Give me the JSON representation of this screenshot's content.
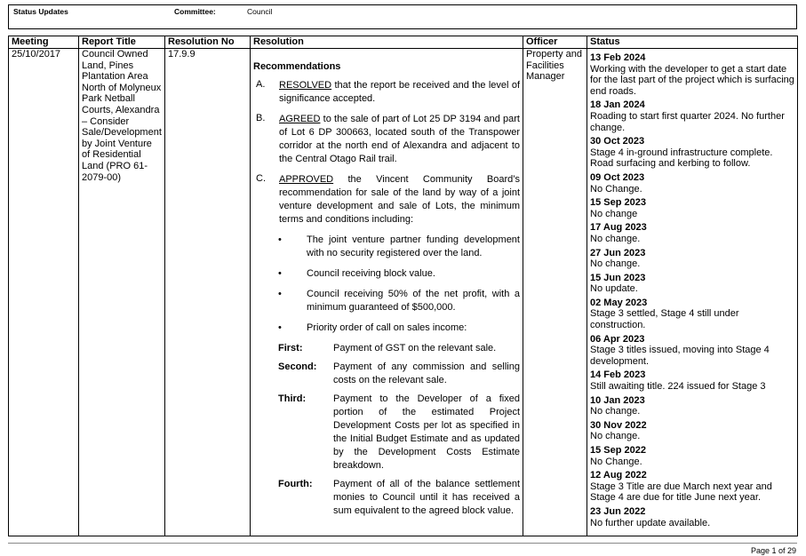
{
  "header": {
    "status_updates_label": "Status Updates",
    "committee_label": "Committee:",
    "committee_value": "Council"
  },
  "table": {
    "columns": [
      "Meeting",
      "Report Title",
      "Resolution No",
      "Resolution",
      "Officer",
      "Status"
    ],
    "row": {
      "meeting": "25/10/2017",
      "report_title": "Council Owned Land, Pines Plantation Area North of Molyneux Park Netball Courts, Alexandra – Consider Sale/Development by Joint Venture of Residential Land (PRO 61-2079-00)",
      "resolution_no": "17.9.9",
      "resolution": {
        "heading": "Recommendations",
        "items": [
          {
            "letter": "A.",
            "keyword": "RESOLVED",
            "text": " that the report be received and the level of significance accepted."
          },
          {
            "letter": "B.",
            "keyword": "AGREED",
            "text": " to the sale of part of Lot 25 DP 3194 and part of Lot 6 DP 300663, located south of the Transpower corridor at the north end of Alexandra and adjacent to the Central Otago Rail trail."
          },
          {
            "letter": "C.",
            "keyword": "APPROVED",
            "text": " the Vincent Community Board’s recommendation for sale of the land by way of a joint venture development and sale of Lots, the minimum terms and conditions including:"
          }
        ],
        "bullets": [
          "The joint venture partner funding development with no security registered over the land.",
          "Council receiving block value.",
          "Council receiving 50% of the net profit, with a minimum guaranteed of $500,000.",
          "Priority order of call on sales income:"
        ],
        "order": [
          {
            "label": "First:",
            "text": "Payment of GST on the relevant sale."
          },
          {
            "label": "Second:",
            "text": "Payment of any commission and selling costs on the relevant sale."
          },
          {
            "label": "Third:",
            "text": "Payment to the Developer of a fixed portion of the estimated Project Development Costs per lot as specified in the Initial Budget Estimate and as updated by the Development Costs Estimate breakdown."
          },
          {
            "label": "Fourth:",
            "text": "Payment of all of the balance settlement monies to Council until it has received a sum equivalent to the agreed block value."
          }
        ]
      },
      "officer": "Property and Facilities Manager",
      "status": [
        {
          "date": "13 Feb 2024",
          "note": "Working with the developer to get a start date for the last part of the project which is surfacing end roads."
        },
        {
          "date": "18 Jan 2024",
          "note": "Roading to start first quarter 2024. No further change."
        },
        {
          "date": "30 Oct 2023",
          "note": "Stage 4 in-ground infrastructure complete. Road surfacing and kerbing to follow."
        },
        {
          "date": "09 Oct 2023",
          "note": "No Change."
        },
        {
          "date": "15 Sep 2023",
          "note": "No change"
        },
        {
          "date": "17 Aug 2023",
          "note": "No change."
        },
        {
          "date": "27 Jun 2023",
          "note": "No change."
        },
        {
          "date": "15 Jun 2023",
          "note": "No update."
        },
        {
          "date": "02 May 2023",
          "note": "Stage 3 settled, Stage 4 still under construction."
        },
        {
          "date": "06 Apr 2023",
          "note": "Stage 3 titles issued, moving into Stage 4 development."
        },
        {
          "date": "14 Feb 2023",
          "note": "Still awaiting title. 224 issued for Stage 3"
        },
        {
          "date": "10 Jan 2023",
          "note": "No change."
        },
        {
          "date": "30 Nov 2022",
          "note": "No change."
        },
        {
          "date": "15 Sep 2022",
          "note": "No Change."
        },
        {
          "date": "12 Aug 2022",
          "note": "Stage 3 Title are due March next year and Stage 4 are due for title June next year."
        },
        {
          "date": "23 Jun 2022",
          "note": "No further update available."
        }
      ]
    }
  },
  "footer": {
    "page": "Page 1 of 29"
  }
}
